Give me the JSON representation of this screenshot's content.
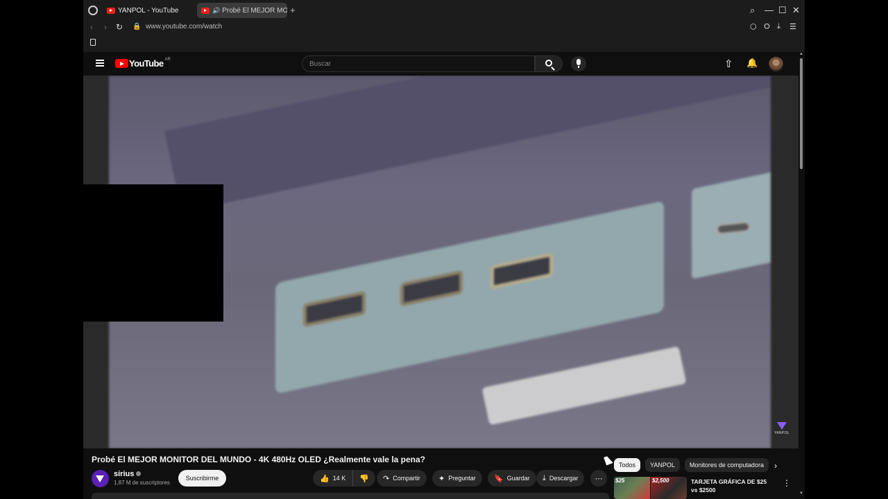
{
  "tabs": [
    {
      "label": "YANPOL - YouTube"
    },
    {
      "label": "Probé El MEJOR MONI"
    }
  ],
  "address_bar": {
    "url": "www.youtube.com/watch"
  },
  "youtube": {
    "logo_text": "YouTube",
    "country_code": "AR",
    "search_placeholder": "Buscar"
  },
  "player": {
    "watermark": "YANPOL"
  },
  "video": {
    "title": "Probé El MEJOR MONITOR DEL MUNDO - 4K 480Hz OLED ¿Realmente vale la pena?",
    "channel_name": "sirius",
    "subscribers": "1,87 M de suscriptores",
    "subscribe_label": "Suscribirme",
    "likes": "14 K",
    "share_label": "Compartir",
    "ask_label": "Preguntar",
    "save_label": "Guardar",
    "download_label": "Descargar"
  },
  "chips": [
    "Todos",
    "YANPOL",
    "Monitores de computadora"
  ],
  "recommendation": {
    "thumb_price_left": "$25",
    "thumb_price_right": "$2,500",
    "title": "TARJETA GRÁFICA DE $25 vs $2500"
  },
  "icons": {
    "menu": "hamburger-icon",
    "search": "search-icon",
    "mic": "microphone-icon",
    "upload": "upload-icon",
    "bell": "notifications-icon",
    "like": "thumbs-up-icon",
    "dislike": "thumbs-down-icon",
    "share": "share-arrow-icon",
    "ask": "sparkle-icon",
    "save": "bookmark-icon",
    "download": "download-icon",
    "more": "more-horizontal-icon"
  },
  "colors": {
    "youtube_red": "#ff0000",
    "background": "#0f0f0f",
    "pill": "#272727",
    "channel_accent": "#5b21b6"
  }
}
